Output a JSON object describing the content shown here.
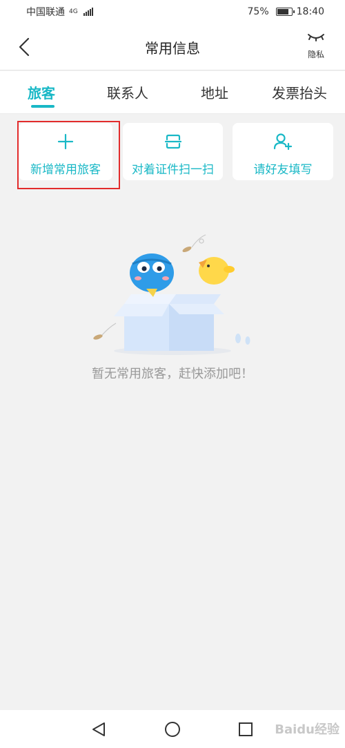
{
  "status_bar": {
    "carrier": "中国联通",
    "network": "4G",
    "battery": "75%",
    "time": "18:40"
  },
  "nav": {
    "title": "常用信息",
    "privacy_label": "隐私"
  },
  "tabs": [
    {
      "label": "旅客"
    },
    {
      "label": "联系人"
    },
    {
      "label": "地址"
    },
    {
      "label": "发票抬头"
    }
  ],
  "actions": [
    {
      "label": "新增常用旅客",
      "icon": "plus-icon"
    },
    {
      "label": "对着证件扫一扫",
      "icon": "scan-icon"
    },
    {
      "label": "请好友填写",
      "icon": "add-friend-icon"
    }
  ],
  "empty_state": {
    "text": "暂无常用旅客，赶快添加吧！"
  },
  "system_nav": {
    "watermark": "Baidu经验"
  },
  "colors": {
    "accent": "#19b8c6",
    "highlight": "#e22b2b",
    "background": "#f2f2f2"
  }
}
